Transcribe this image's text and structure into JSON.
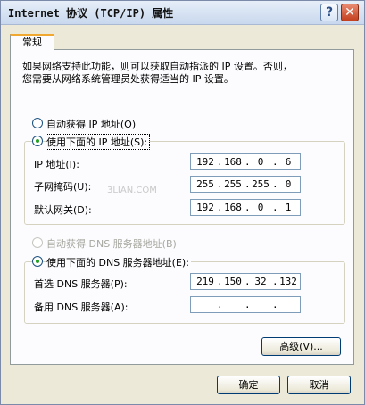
{
  "window": {
    "title": "Internet 协议 (TCP/IP) 属性",
    "help_glyph": "?",
    "close_glyph": "✕"
  },
  "tab": {
    "label": "常规"
  },
  "description": "如果网络支持此功能，则可以获取自动指派的 IP 设置。否则，\n您需要从网络系统管理员处获得适当的 IP 设置。",
  "ip_mode": {
    "auto_label": "自动获得 IP 地址(O)",
    "manual_label": "使用下面的 IP 地址(S):",
    "selected": "manual"
  },
  "ip_fields": [
    {
      "label": "IP 地址(I):",
      "octets": [
        "192",
        "168",
        "0",
        "6"
      ]
    },
    {
      "label": "子网掩码(U):",
      "octets": [
        "255",
        "255",
        "255",
        "0"
      ]
    },
    {
      "label": "默认网关(D):",
      "octets": [
        "192",
        "168",
        "0",
        "1"
      ]
    }
  ],
  "dns_mode": {
    "auto_label": "自动获得 DNS 服务器地址(B)",
    "manual_label": "使用下面的 DNS 服务器地址(E):",
    "selected": "manual",
    "auto_disabled": true
  },
  "dns_fields": [
    {
      "label": "首选 DNS 服务器(P):",
      "octets": [
        "219",
        "150",
        "32",
        "132"
      ]
    },
    {
      "label": "备用 DNS 服务器(A):",
      "octets": [
        "",
        "",
        "",
        ""
      ]
    }
  ],
  "separator": ".",
  "watermark": "3LIAN.COM",
  "buttons": {
    "advanced": "高级(V)...",
    "ok": "确定",
    "cancel": "取消"
  }
}
